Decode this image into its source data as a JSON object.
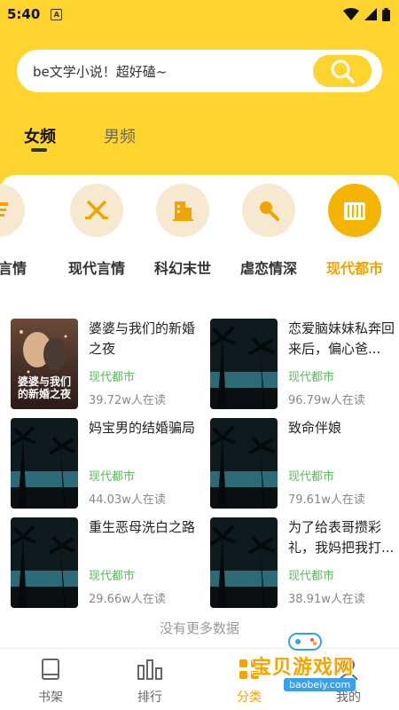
{
  "status": {
    "time": "5:40",
    "notif_letter": "A"
  },
  "search": {
    "placeholder_text": "be文学小说！超好磕~"
  },
  "tabs": [
    {
      "label": "女频"
    },
    {
      "label": "男频"
    }
  ],
  "categories": [
    {
      "label": "古代言情",
      "icon": "emperor-icon"
    },
    {
      "label": "现代言情",
      "icon": "crossed-swords-icon"
    },
    {
      "label": "科幻末世",
      "icon": "building-icon"
    },
    {
      "label": "虐恋情深",
      "icon": "magnifier-icon"
    },
    {
      "label": "现代都市",
      "icon": "city-icon"
    }
  ],
  "books": [
    {
      "title": "婆婆与我们的新婚之夜",
      "category": "现代都市",
      "reads": "39.72w人在读",
      "cover_text": "婆婆与我们的新婚之夜"
    },
    {
      "title": "恋爱脑妹妹私奔回来后，偏心爸...",
      "category": "现代都市",
      "reads": "96.79w人在读"
    },
    {
      "title": "妈宝男的结婚骗局",
      "category": "现代都市",
      "reads": "44.03w人在读"
    },
    {
      "title": "致命伴娘",
      "category": "现代都市",
      "reads": "79.61w人在读"
    },
    {
      "title": "重生恶母洗白之路",
      "category": "现代都市",
      "reads": "29.66w人在读"
    },
    {
      "title": "为了给表哥攒彩礼，我妈把我打...",
      "category": "现代都市",
      "reads": "38.91w人在读"
    }
  ],
  "no_more": "没有更多数据",
  "nav": [
    {
      "label": "书架",
      "icon": "book-icon"
    },
    {
      "label": "排行",
      "icon": "bar-chart-icon"
    },
    {
      "label": "分类",
      "icon": "category-icon"
    },
    {
      "label": "我的",
      "icon": "profile-icon"
    }
  ],
  "watermark": {
    "text": "宝贝游戏网",
    "url": "baobeiy.com"
  },
  "colors": {
    "accent": "#ffd42e",
    "active": "#f0a400",
    "category_text": "#5cb85c"
  }
}
